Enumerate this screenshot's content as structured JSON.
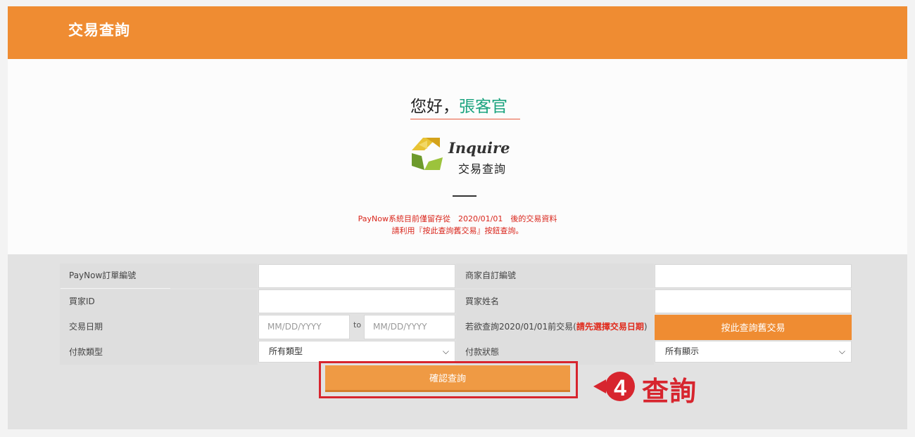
{
  "header": {
    "title": "交易查詢"
  },
  "greeting": {
    "prefix": "您好，",
    "name": "張客官"
  },
  "logo": {
    "en": "Inquire",
    "zh": "交易查詢"
  },
  "notice": {
    "line1": "PayNow系統目前僅留存從　2020/01/01　後的交易資料",
    "line2": "請利用『按此查詢舊交易』按鈕查詢。"
  },
  "form": {
    "order_no_label": "PayNow訂單編號",
    "merchant_no_label": "商家自訂編號",
    "buyer_id_label": "買家ID",
    "buyer_name_label": "買家姓名",
    "date_label": "交易日期",
    "date_from_placeholder": "MM/DD/YYYY",
    "date_to_placeholder": "MM/DD/YYYY",
    "date_to_sep": "to",
    "old_query_hint": "若欲查詢2020/01/01前交易(",
    "old_query_hint_warn": "請先選擇交易日期",
    "old_query_hint_end": ")",
    "old_query_button": "按此查詢舊交易",
    "payment_type_label": "付款類型",
    "payment_type_value": "所有類型",
    "payment_status_label": "付款狀態",
    "payment_status_value": "所有顯示"
  },
  "confirm_button": "確認查詢",
  "annotation": {
    "step": "4",
    "text": "查詢",
    "color": "#d7252e"
  },
  "colors": {
    "brand": "#ef8c32",
    "name": "#1aa37e",
    "alert": "#d9251b"
  }
}
